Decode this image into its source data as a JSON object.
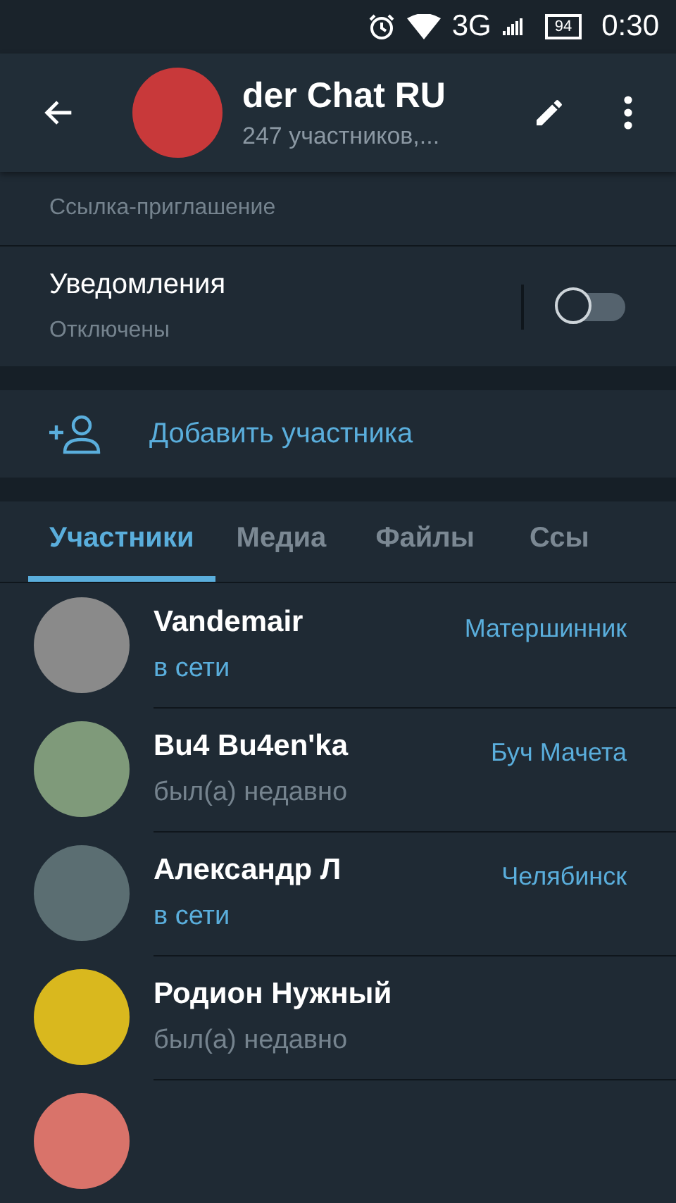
{
  "status_bar": {
    "network": "3G",
    "battery": "94",
    "time": "0:30"
  },
  "header": {
    "title": "der Chat RU",
    "subtitle": "247 участников,..."
  },
  "invite": {
    "caption": "Ссылка-приглашение"
  },
  "notifications": {
    "title": "Уведомления",
    "status": "Отключены",
    "on": false
  },
  "add_member": {
    "label": "Добавить участника"
  },
  "tabs": [
    {
      "label": "Участники",
      "selected": true
    },
    {
      "label": "Медиа",
      "selected": false
    },
    {
      "label": "Файлы",
      "selected": false
    },
    {
      "label": "Ссы",
      "selected": false
    }
  ],
  "members": [
    {
      "name": "Vandemair",
      "status": "в сети",
      "online": true,
      "title": "Матершинник",
      "color": "#8a8a8a"
    },
    {
      "name": "Bu4 Bu4en'ka",
      "status": "был(а) недавно",
      "online": false,
      "title": "Буч Мачета",
      "color": "#7f9a7a"
    },
    {
      "name": "Александр Л",
      "status": "в сети",
      "online": true,
      "title": "Челябинск",
      "color": "#5b6e72"
    },
    {
      "name": "Родион Нужный",
      "status": "был(а) недавно",
      "online": false,
      "color": "#d9b81e"
    }
  ]
}
